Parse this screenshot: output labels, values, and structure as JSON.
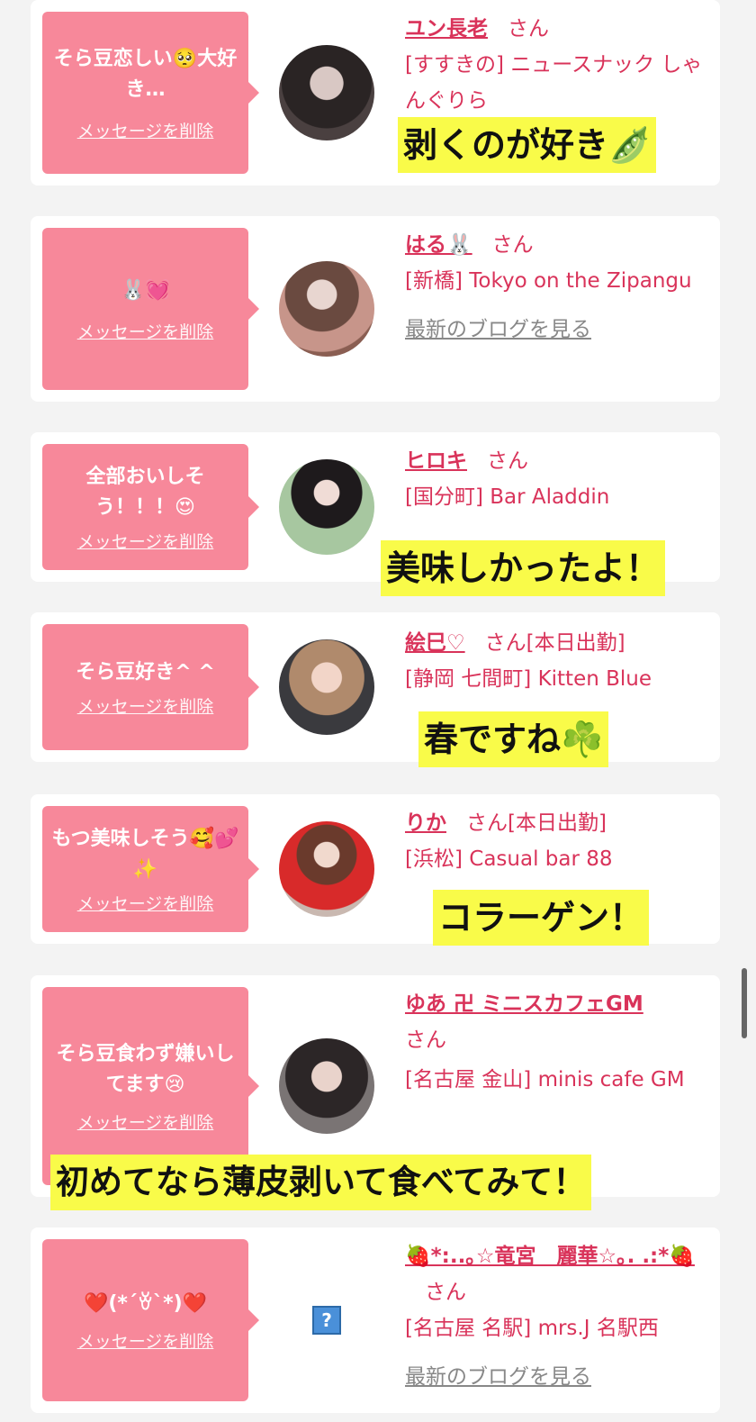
{
  "delete_label": "メッセージを削除",
  "honorific": "さん",
  "blog_label": "最新のブログを見る",
  "items": [
    {
      "message": "そら豆恋しい🥺大好き…",
      "name": "ユン長老",
      "status": "",
      "shop": "[すすきの] ニュースナック しゃんぐりら",
      "caption": "剥くのが好き🫛"
    },
    {
      "message": "🐰💓",
      "name": "はる🐰",
      "status": "",
      "shop": "[新橋] Tokyo on the Zipangu",
      "caption": ""
    },
    {
      "message": "全部おいしそう！！！😍",
      "name": "ヒロキ",
      "status": "",
      "shop": "[国分町] Bar Aladdin",
      "caption": "美味しかったよ！"
    },
    {
      "message": "そら豆好き^ ^",
      "name": "絵巳♡",
      "status": "[本日出勤]",
      "shop": "[静岡 七間町] Kitten Blue",
      "caption": "春ですね☘️"
    },
    {
      "message": "もつ美味しそう🥰💕✨",
      "name": "りか",
      "status": "[本日出勤]",
      "shop": "[浜松] Casual bar 88",
      "caption": "コラーゲン！"
    },
    {
      "message": "そら豆食わず嫌いしてます😢",
      "name": "ゆあ 卍 ミニスカフェGM",
      "status": "",
      "shop": "[名古屋 金山] minis cafe GM",
      "caption": "初めてなら薄皮剥いて食べてみて！"
    },
    {
      "message": "❤️(*´ꈊ`*)❤️",
      "name": "🍓*:..｡☆竜宮　麗華☆｡. .:*🍓",
      "status": "",
      "shop": "[名古屋 名駅] mrs.J 名駅西",
      "caption": ""
    }
  ]
}
